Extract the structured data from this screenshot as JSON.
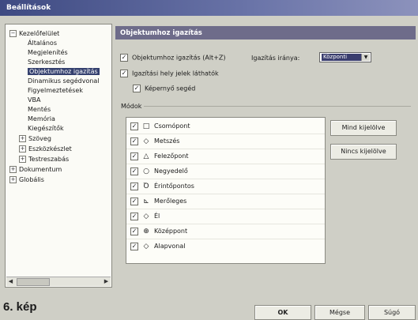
{
  "window": {
    "title": "Beállítások"
  },
  "tree": {
    "items": [
      {
        "label": "Kezelőfelület",
        "expander": "−",
        "level": 0
      },
      {
        "label": "Általános",
        "level": 1
      },
      {
        "label": "Megjelenítés",
        "level": 1
      },
      {
        "label": "Szerkesztés",
        "level": 1
      },
      {
        "label": "Objektumhoz igazítás",
        "level": 1,
        "selected": true
      },
      {
        "label": "Dinamikus segédvonal",
        "level": 1
      },
      {
        "label": "Figyelmeztetések",
        "level": 1
      },
      {
        "label": "VBA",
        "level": 1
      },
      {
        "label": "Mentés",
        "level": 1
      },
      {
        "label": "Memória",
        "level": 1
      },
      {
        "label": "Kiegészítők",
        "level": 1
      },
      {
        "label": "Szöveg",
        "expander": "+",
        "level": 1
      },
      {
        "label": "Eszközkészlet",
        "expander": "+",
        "level": 1
      },
      {
        "label": "Testreszabás",
        "expander": "+",
        "level": 1
      },
      {
        "label": "Dokumentum",
        "expander": "+",
        "level": 0
      },
      {
        "label": "Globális",
        "expander": "+",
        "level": 0
      }
    ]
  },
  "panel": {
    "title": "Objektumhoz igazítás",
    "snap_option": {
      "label": "Objektumhoz igazítás (Alt+Z)",
      "checked": true
    },
    "snap_reach_label": "Igazítás iránya:",
    "snap_reach_value": "Központi",
    "snap_visible": {
      "label": "Igazítási hely jelek láthatók",
      "checked": true
    },
    "magnet": {
      "label": "Képernyő segéd",
      "checked": true
    },
    "modes_label": "Módok",
    "modes": [
      {
        "symbol": "□",
        "label": "Csomópont",
        "checked": true
      },
      {
        "symbol": "◇",
        "label": "Metszés",
        "checked": true
      },
      {
        "symbol": "△",
        "label": "Felezőpont",
        "checked": true
      },
      {
        "symbol": "○",
        "label": "Negyedelő",
        "checked": true
      },
      {
        "symbol": "Ꝺ",
        "label": "Érintőpontos",
        "checked": true
      },
      {
        "symbol": "⊾",
        "label": "Merőleges",
        "checked": true
      },
      {
        "symbol": "◇",
        "label": "Él",
        "checked": true
      },
      {
        "symbol": "⊕",
        "label": "Középpont",
        "checked": true
      },
      {
        "symbol": "◇",
        "label": "Alapvonal",
        "checked": true
      }
    ],
    "select_all_label": "Mind kijelölve",
    "deselect_all_label": "Nincs kijelölve"
  },
  "footer": {
    "caption": "6. kép",
    "ok_label": "OK",
    "cancel_label": "Mégse",
    "help_label": "Súgó"
  }
}
